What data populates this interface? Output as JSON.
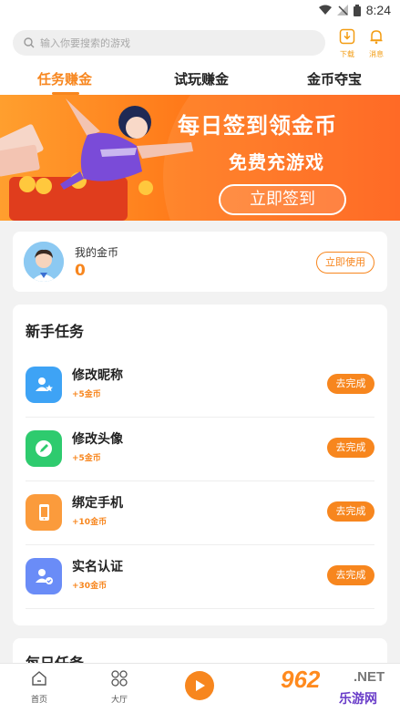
{
  "status_bar": {
    "time": "8:24"
  },
  "header": {
    "search_placeholder": "输入你要搜索的游戏",
    "download_label": "下载",
    "message_label": "消息"
  },
  "tabs": [
    {
      "label": "任务赚金",
      "active": true
    },
    {
      "label": "试玩赚金",
      "active": false
    },
    {
      "label": "金币夺宝",
      "active": false
    }
  ],
  "banner": {
    "title": "每日签到领金币",
    "subtitle": "免费充游戏",
    "button": "立即签到"
  },
  "coins": {
    "label": "我的金币",
    "value": "0",
    "use_button": "立即使用"
  },
  "novice_tasks": {
    "title": "新手任务",
    "items": [
      {
        "name": "修改昵称",
        "reward": "+5金币",
        "button": "去完成",
        "icon": "user-star-icon",
        "color": "#3ea3f5"
      },
      {
        "name": "修改头像",
        "reward": "+5金币",
        "button": "去完成",
        "icon": "pencil-icon",
        "color": "#2ecb6e"
      },
      {
        "name": "绑定手机",
        "reward": "+10金币",
        "button": "去完成",
        "icon": "phone-icon",
        "color": "#fb9b3c"
      },
      {
        "name": "实名认证",
        "reward": "+30金币",
        "button": "去完成",
        "icon": "user-check-icon",
        "color": "#6a8cf7"
      }
    ]
  },
  "daily_tasks": {
    "title": "每日任务"
  },
  "bottom_nav": [
    {
      "label": "首页",
      "icon": "home-icon"
    },
    {
      "label": "大厅",
      "icon": "grid-icon"
    },
    {
      "label": "",
      "icon": "play-icon"
    }
  ],
  "watermark": {
    "main": "962",
    "net": ".NET",
    "sub": "乐游网"
  },
  "colors": {
    "accent": "#f7861e"
  }
}
